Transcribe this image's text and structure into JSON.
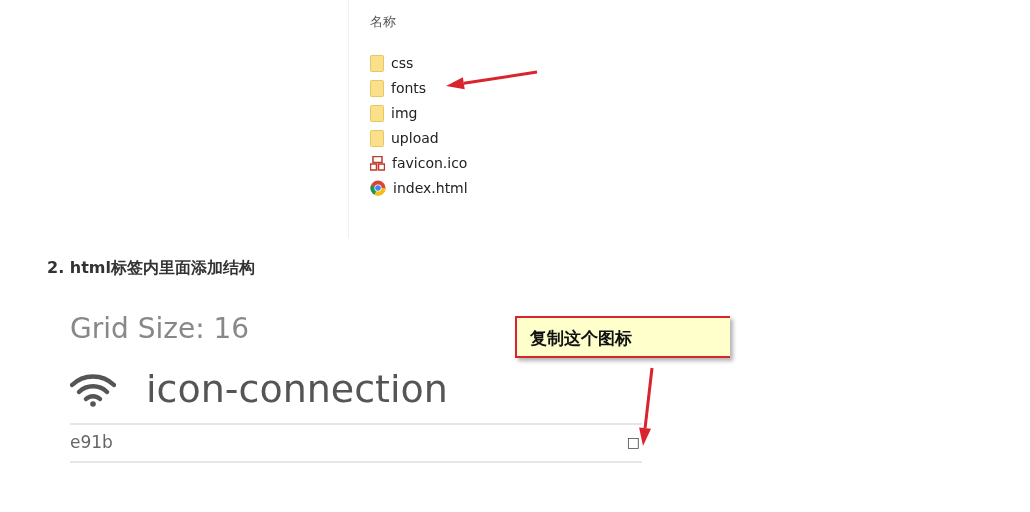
{
  "explorer": {
    "column_header": "名称",
    "items": [
      {
        "name": "css",
        "kind": "folder"
      },
      {
        "name": "fonts",
        "kind": "folder"
      },
      {
        "name": "img",
        "kind": "folder"
      },
      {
        "name": "upload",
        "kind": "folder"
      },
      {
        "name": "favicon.ico",
        "kind": "ico"
      },
      {
        "name": "index.html",
        "kind": "html"
      }
    ]
  },
  "heading": "2. html标签内里面添加结构",
  "icon_page": {
    "grid_size": "Grid Size: 16",
    "icon_name": "icon-connection",
    "code": "e91b",
    "glyph": "□"
  },
  "callout": {
    "text": "复制这个图标"
  }
}
